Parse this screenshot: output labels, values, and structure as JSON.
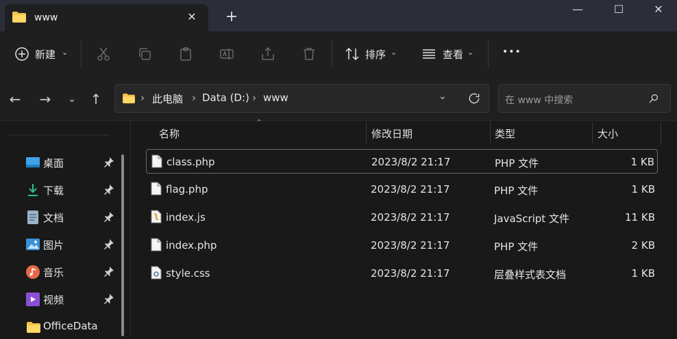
{
  "window": {
    "tab_title": "www",
    "new_tab": "+",
    "minimize": "—",
    "maximize": "☐",
    "close": "✕"
  },
  "toolbar": {
    "new_label": "新建",
    "sort_label": "排序",
    "view_label": "查看",
    "more_label": "•••"
  },
  "address": {
    "crumbs": [
      "此电脑",
      "Data (D:)",
      "www"
    ],
    "search_placeholder": "在 www 中搜索"
  },
  "sidebar": {
    "items": [
      {
        "label": "桌面"
      },
      {
        "label": "下载"
      },
      {
        "label": "文档"
      },
      {
        "label": "图片"
      },
      {
        "label": "音乐"
      },
      {
        "label": "视频"
      },
      {
        "label": "OfficeData"
      }
    ]
  },
  "columns": {
    "name": "名称",
    "modified": "修改日期",
    "type": "类型",
    "size": "大小"
  },
  "files": [
    {
      "name": "class.php",
      "modified": "2023/8/2 21:17",
      "type": "PHP 文件",
      "size": "1 KB"
    },
    {
      "name": "flag.php",
      "modified": "2023/8/2 21:17",
      "type": "PHP 文件",
      "size": "1 KB"
    },
    {
      "name": "index.js",
      "modified": "2023/8/2 21:17",
      "type": "JavaScript 文件",
      "size": "11 KB"
    },
    {
      "name": "index.php",
      "modified": "2023/8/2 21:17",
      "type": "PHP 文件",
      "size": "2 KB"
    },
    {
      "name": "style.css",
      "modified": "2023/8/2 21:17",
      "type": "层叠样式表文档",
      "size": "1 KB"
    }
  ],
  "colors": {
    "folder": "#f3c24a",
    "accent": "#4aa3f0"
  }
}
